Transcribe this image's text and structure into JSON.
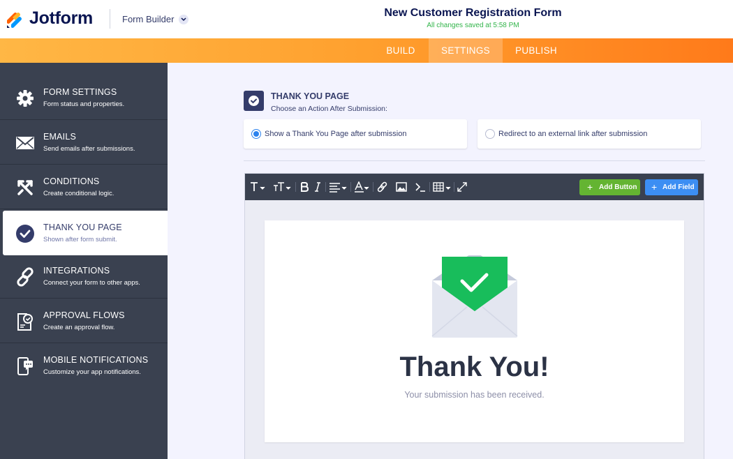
{
  "header": {
    "brand": "Jotform",
    "builder_label": "Form Builder",
    "form_title": "New Customer Registration Form",
    "save_status": "All changes saved at 5:58 PM",
    "brand_colors": {
      "orange": "#ff6100",
      "blue": "#0099ff",
      "yellow": "#ffb629",
      "navy": "#0a1551"
    }
  },
  "nav": {
    "tabs": [
      {
        "label": "BUILD",
        "active": false
      },
      {
        "label": "SETTINGS",
        "active": true
      },
      {
        "label": "PUBLISH",
        "active": false
      }
    ]
  },
  "sidebar": {
    "items": [
      {
        "title": "FORM SETTINGS",
        "desc": "Form status and properties.",
        "icon": "gear-icon"
      },
      {
        "title": "EMAILS",
        "desc": "Send emails after submissions.",
        "icon": "envelope-icon"
      },
      {
        "title": "CONDITIONS",
        "desc": "Create conditional logic.",
        "icon": "conditions-icon"
      },
      {
        "title": "THANK YOU PAGE",
        "desc": "Shown after form submit.",
        "icon": "check-circle-icon",
        "active": true
      },
      {
        "title": "INTEGRATIONS",
        "desc": "Connect your form to other apps.",
        "icon": "link-icon"
      },
      {
        "title": "APPROVAL FLOWS",
        "desc": "Create an approval flow.",
        "icon": "approval-icon"
      },
      {
        "title": "MOBILE NOTIFICATIONS",
        "desc": "Customize your app notifications.",
        "icon": "mobile-notification-icon"
      }
    ]
  },
  "section": {
    "title": "THANK YOU PAGE",
    "subtitle": "Choose an Action After Submission:",
    "options": [
      {
        "label": "Show a Thank You Page after submission",
        "selected": true
      },
      {
        "label": "Redirect to an external link after submission",
        "selected": false
      }
    ]
  },
  "editor": {
    "toolbar_icons": [
      "font-icon",
      "font-size-icon",
      "bold-icon",
      "italic-icon",
      "align-icon",
      "text-color-icon",
      "link-icon",
      "image-icon",
      "code-icon",
      "table-icon",
      "fullscreen-icon"
    ],
    "add_button_label": "Add Button",
    "add_field_label": "Add Field",
    "add_button_color": "#64b432",
    "add_field_color": "#3c8ef3"
  },
  "thank_you": {
    "heading": "Thank You!",
    "message": "Your submission has been received.",
    "accent": "#18bd5b"
  }
}
